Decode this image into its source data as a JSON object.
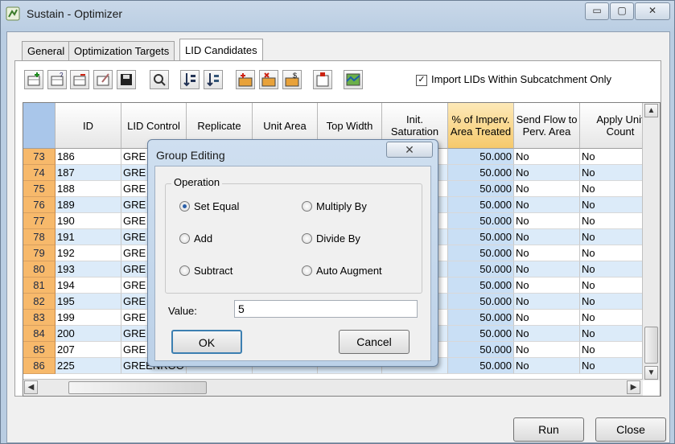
{
  "window": {
    "title": "Sustain - Optimizer"
  },
  "tabs": [
    {
      "label": "General"
    },
    {
      "label": "Optimization Targets"
    },
    {
      "label": "LID Candidates"
    }
  ],
  "toolbar": {
    "import_checkbox_label": "Import LIDs Within Subcatchment Only",
    "import_checked": true,
    "icons": [
      "add-row-icon",
      "insert-row-icon",
      "delete-row-icon",
      "edit-icon",
      "save-icon",
      "search-icon",
      "sort-ascending-icon",
      "sort-descending-icon",
      "group-edit-icon",
      "group-edit-multiply-icon",
      "group-edit-dollar-icon",
      "delete-icon",
      "map-icon"
    ]
  },
  "grid": {
    "columns": [
      "ID",
      "LID Control",
      "Replicate",
      "Unit Area",
      "Top Width",
      "Init. Saturation",
      "% of Imperv. Area Treated",
      "Send Flow to Perv. Area",
      "Apply Unit Count"
    ],
    "rows": [
      {
        "n": "73",
        "id": "186",
        "lid": "GRE",
        "pct": "50.000",
        "send": "No",
        "apply": "No"
      },
      {
        "n": "74",
        "id": "187",
        "lid": "GRE",
        "pct": "50.000",
        "send": "No",
        "apply": "No"
      },
      {
        "n": "75",
        "id": "188",
        "lid": "GRE",
        "pct": "50.000",
        "send": "No",
        "apply": "No"
      },
      {
        "n": "76",
        "id": "189",
        "lid": "GRE",
        "pct": "50.000",
        "send": "No",
        "apply": "No"
      },
      {
        "n": "77",
        "id": "190",
        "lid": "GRE",
        "pct": "50.000",
        "send": "No",
        "apply": "No"
      },
      {
        "n": "78",
        "id": "191",
        "lid": "GRE",
        "pct": "50.000",
        "send": "No",
        "apply": "No"
      },
      {
        "n": "79",
        "id": "192",
        "lid": "GRE",
        "pct": "50.000",
        "send": "No",
        "apply": "No"
      },
      {
        "n": "80",
        "id": "193",
        "lid": "GRE",
        "pct": "50.000",
        "send": "No",
        "apply": "No"
      },
      {
        "n": "81",
        "id": "194",
        "lid": "GRE",
        "pct": "50.000",
        "send": "No",
        "apply": "No"
      },
      {
        "n": "82",
        "id": "195",
        "lid": "GRE",
        "pct": "50.000",
        "send": "No",
        "apply": "No"
      },
      {
        "n": "83",
        "id": "199",
        "lid": "GRE",
        "pct": "50.000",
        "send": "No",
        "apply": "No"
      },
      {
        "n": "84",
        "id": "200",
        "lid": "GRE",
        "pct": "50.000",
        "send": "No",
        "apply": "No"
      },
      {
        "n": "85",
        "id": "207",
        "lid": "GRE",
        "pct": "50.000",
        "send": "No",
        "apply": "No"
      },
      {
        "n": "86",
        "id": "225",
        "lid": "GREENROO",
        "pct": "50.000",
        "send": "No",
        "apply": "No"
      }
    ]
  },
  "buttons": {
    "run": "Run",
    "close": "Close"
  },
  "dialog": {
    "title": "Group Editing",
    "group_label": "Operation",
    "options": [
      "Set Equal",
      "Multiply By",
      "Add",
      "Divide By",
      "Subtract",
      "Auto Augment"
    ],
    "selected_option": "Set Equal",
    "value_label": "Value:",
    "value": "5",
    "ok": "OK",
    "cancel": "Cancel"
  }
}
